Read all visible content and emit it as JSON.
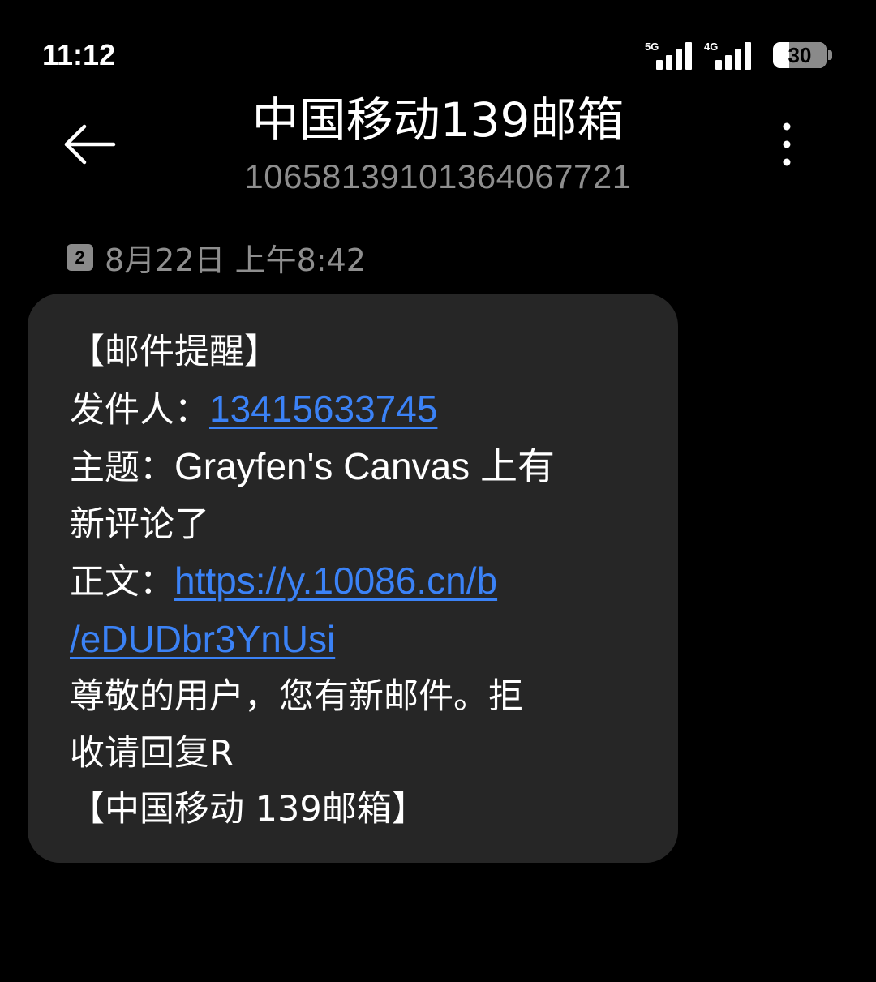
{
  "status_bar": {
    "time": "11:12",
    "network_1": "5G",
    "network_2": "4G",
    "battery_level": "30",
    "battery_fraction": 0.3
  },
  "header": {
    "contact_name": "中国移动139邮箱",
    "contact_number": "10658139101364067721",
    "back_icon": "arrow-left-icon",
    "more_icon": "more-vertical-icon"
  },
  "timestamp": {
    "sim_slot": "2",
    "text": "8月22日 上午8:42"
  },
  "message": {
    "line_title": "【邮件提醒】",
    "sender_label": "发件人：",
    "sender_number": "13415633745",
    "subject_label": "主题：",
    "subject_text_line1": "Grayfen's Canvas 上有",
    "subject_text_line2": "新评论了",
    "body_label": "正文：",
    "body_link_line1": "https://y.10086.cn/b",
    "body_link_line2": "/eDUDbr3YnUsi",
    "notice_line1": "尊敬的用户，您有新邮件。拒",
    "notice_line2": "收请回复R",
    "signature": "【中国移动 139邮箱】"
  },
  "colors": {
    "background": "#000000",
    "bubble": "#262626",
    "link": "#3b82f6",
    "secondary_text": "#8e8e8e"
  }
}
